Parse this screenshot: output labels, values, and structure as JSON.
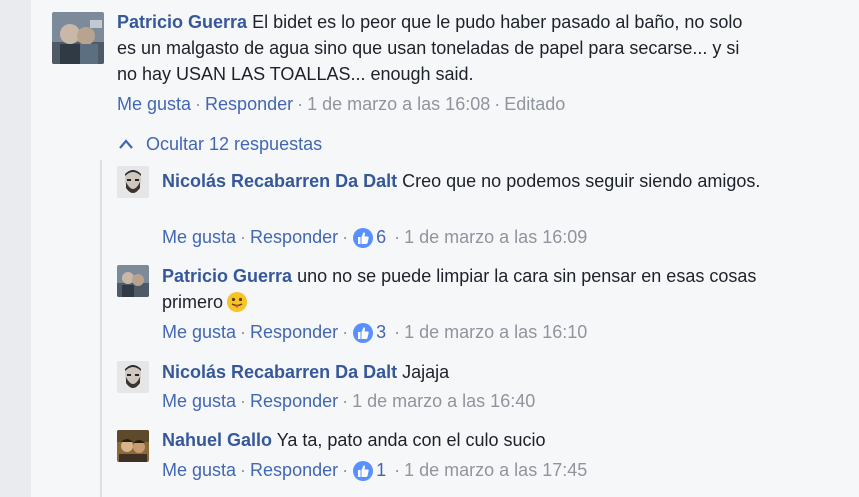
{
  "main_comment": {
    "author": "Patricio Guerra",
    "text": "El bidet es lo peor que le pudo haber pasado al baño, no solo es un malgasto de agua sino que usan toneladas de papel para secarse... y si no hay USAN LAS TOALLAS... enough said.",
    "like_label": "Me gusta",
    "reply_label": "Responder",
    "timestamp": "1 de marzo a las 16:08",
    "edited_label": "Editado"
  },
  "hide_replies_label": "Ocultar 12 respuestas",
  "replies": [
    {
      "author": "Nicolás Recabarren Da Dalt",
      "text": "Creo que no podemos seguir siendo amigos.",
      "like_label": "Me gusta",
      "reply_label": "Responder",
      "likes": "6",
      "timestamp": "1 de marzo a las 16:09"
    },
    {
      "author": "Patricio Guerra",
      "text": "uno no se puede limpiar la cara sin pensar en esas cosas primero",
      "like_label": "Me gusta",
      "reply_label": "Responder",
      "likes": "3",
      "timestamp": "1 de marzo a las 16:10"
    },
    {
      "author": "Nicolás Recabarren Da Dalt",
      "text": "Jajaja",
      "like_label": "Me gusta",
      "reply_label": "Responder",
      "timestamp": "1 de marzo a las 16:40"
    },
    {
      "author": "Nahuel Gallo",
      "text": "Ya ta, pato anda con el culo sucio",
      "like_label": "Me gusta",
      "reply_label": "Responder",
      "likes": "1",
      "timestamp": "1 de marzo a las 17:45"
    }
  ],
  "icons": {
    "like_badge": "thumbs-up-icon",
    "hide_replies": "chevron-up-icon",
    "emoji": "tongue-face-emoji-icon"
  },
  "colors": {
    "author_link": "#365899",
    "action_link": "#4267b2",
    "meta_text": "#90949c",
    "background": "#f6f7f9"
  }
}
